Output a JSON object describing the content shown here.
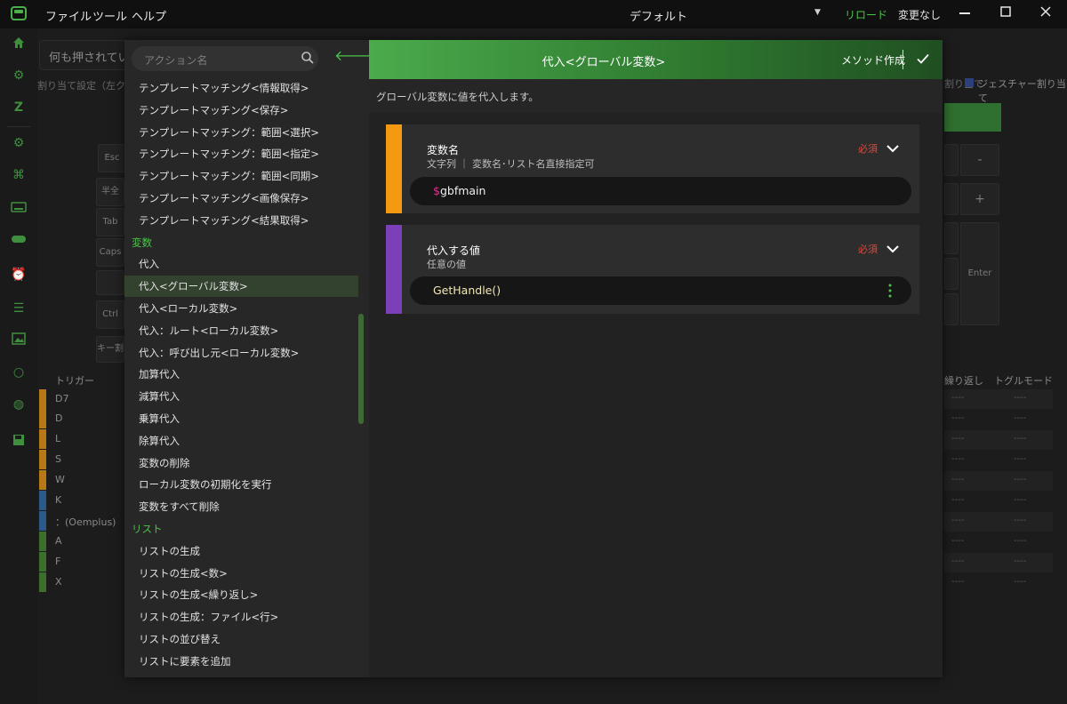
{
  "titlebar": {
    "menus": [
      "ファイル",
      "ツール",
      "ヘルプ"
    ],
    "profile": "デフォルト",
    "reload": "リロード",
    "status": "変更なし"
  },
  "background": {
    "search_text": "何も押されていな",
    "assign_text": "割り当て設定（左クリ",
    "keys": [
      "Esc",
      "半全",
      "Tab",
      "Caps",
      "Ctrl",
      "キー割"
    ],
    "right_keys": [
      "-",
      "+",
      "Enter"
    ],
    "trigger_header": "トリガー",
    "triggers": [
      "D7",
      "D",
      "L",
      "S",
      "W",
      "K",
      "：(Oemplus)",
      "A",
      "F",
      "X"
    ],
    "right_headers": [
      "繰り返し",
      "トグルモード"
    ],
    "assign_right": "割り当て",
    "gesture_label": "ジェスチャー割り当て",
    "dash": "----"
  },
  "dialog": {
    "search_placeholder": "アクション名",
    "list": [
      {
        "type": "item",
        "label": "テンプレートマッチング<情報取得>"
      },
      {
        "type": "item",
        "label": "テンプレートマッチング<保存>"
      },
      {
        "type": "item",
        "label": "テンプレートマッチング：範囲<選択>"
      },
      {
        "type": "item",
        "label": "テンプレートマッチング：範囲<指定>"
      },
      {
        "type": "item",
        "label": "テンプレートマッチング：範囲<同期>"
      },
      {
        "type": "item",
        "label": "テンプレートマッチング<画像保存>"
      },
      {
        "type": "item",
        "label": "テンプレートマッチング<結果取得>"
      },
      {
        "type": "category",
        "label": "変数"
      },
      {
        "type": "item",
        "label": "代入"
      },
      {
        "type": "item",
        "label": "代入<グローバル変数>",
        "selected": true
      },
      {
        "type": "item",
        "label": "代入<ローカル変数>"
      },
      {
        "type": "item",
        "label": "代入：ルート<ローカル変数>"
      },
      {
        "type": "item",
        "label": "代入：呼び出し元<ローカル変数>"
      },
      {
        "type": "item",
        "label": "加算代入"
      },
      {
        "type": "item",
        "label": "減算代入"
      },
      {
        "type": "item",
        "label": "乗算代入"
      },
      {
        "type": "item",
        "label": "除算代入"
      },
      {
        "type": "item",
        "label": "変数の削除"
      },
      {
        "type": "item",
        "label": "ローカル変数の初期化を実行"
      },
      {
        "type": "item",
        "label": "変数をすべて削除"
      },
      {
        "type": "category",
        "label": "リスト"
      },
      {
        "type": "item",
        "label": "リストの生成"
      },
      {
        "type": "item",
        "label": "リストの生成<数>"
      },
      {
        "type": "item",
        "label": "リストの生成<繰り返し>"
      },
      {
        "type": "item",
        "label": "リストの生成：ファイル<行>"
      },
      {
        "type": "item",
        "label": "リストの並び替え"
      },
      {
        "type": "item",
        "label": "リストに要素を追加"
      }
    ],
    "header_title": "代入<グローバル変数>",
    "method_button": "メソッド作成",
    "description": "グローバル変数に値を代入します。",
    "cards": [
      {
        "title": "変数名",
        "subtitle": "文字列 ｜ 変数名･リスト名直接指定可",
        "required": "必須",
        "value_sigil": "$",
        "value": "gbfmain",
        "color": "#f39a12"
      },
      {
        "title": "代入する値",
        "subtitle": "任意の値",
        "required": "必須",
        "value_sigil": "",
        "value": "GetHandle()",
        "color": "#7b3fb8"
      }
    ]
  },
  "colors": {
    "accent": "#4cc34c",
    "required": "#e2483b",
    "orange": "#f39a12",
    "purple": "#7b3fb8",
    "blue": "#2a5a8c",
    "green_bar": "#3c6e2c"
  }
}
